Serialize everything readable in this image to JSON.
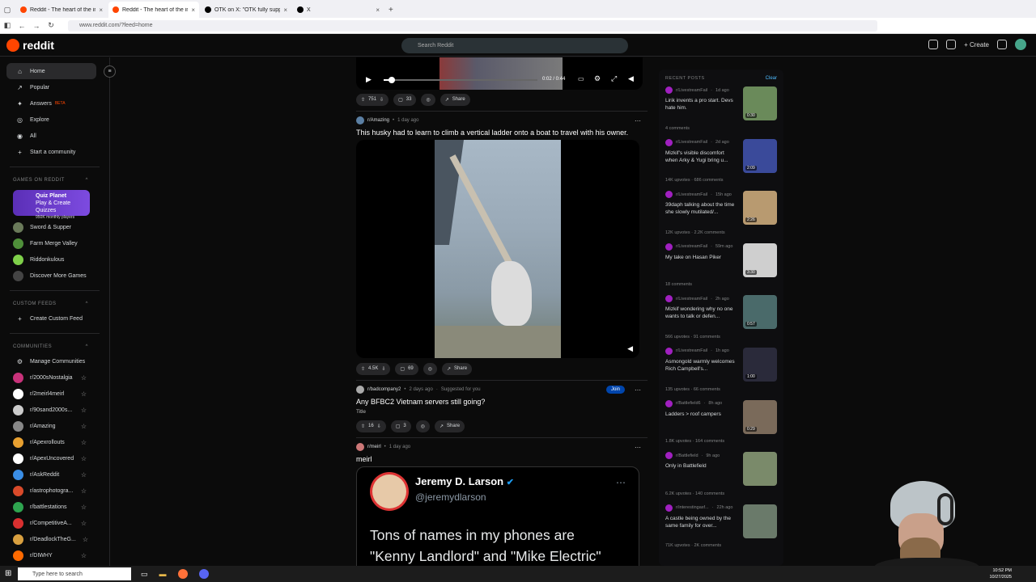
{
  "browser": {
    "tabs": [
      {
        "title": "Reddit - The heart of the intern",
        "active": false,
        "color": "#ff4500"
      },
      {
        "title": "Reddit - The heart of the in",
        "active": true,
        "color": "#ff4500"
      },
      {
        "title": "OTK on X: \"OTK fully supports c",
        "active": false,
        "color": "#000000"
      },
      {
        "title": "X",
        "active": false,
        "color": "#000000"
      }
    ],
    "url": "www.reddit.com/?feed=home"
  },
  "header": {
    "logo": "reddit",
    "search_placeholder": "Search Reddit",
    "create": "Create",
    "chat_badge": "1",
    "notif_badge": "1"
  },
  "sidebar": {
    "nav": [
      {
        "label": "Home",
        "icon": "home-icon",
        "active": true
      },
      {
        "label": "Popular",
        "icon": "popular-icon"
      },
      {
        "label": "Answers",
        "badge": "BETA",
        "icon": "answers-icon"
      },
      {
        "label": "Explore",
        "icon": "explore-icon"
      },
      {
        "label": "All",
        "icon": "all-icon"
      },
      {
        "label": "Start a community",
        "icon": "plus-icon"
      }
    ],
    "games_heading": "GAMES ON REDDIT",
    "quiz": {
      "title": "Quiz Planet",
      "subtitle": "Play & Create Quizzes",
      "players": "950K monthly players",
      "icon_text": "QUIZ"
    },
    "games": [
      {
        "label": "Sword & Supper",
        "color": "#6a7a5a"
      },
      {
        "label": "Farm Merge Valley",
        "color": "#4f8f3a"
      },
      {
        "label": "Riddonkulous",
        "color": "#7fd04a"
      },
      {
        "label": "Discover More Games",
        "color": "#444"
      }
    ],
    "custom_heading": "CUSTOM FEEDS",
    "create_feed": "Create Custom Feed",
    "communities_heading": "COMMUNITIES",
    "manage": "Manage Communities",
    "communities": [
      {
        "label": "r/2000sNostalgia",
        "color": "#c8327a"
      },
      {
        "label": "r/2meirl4meirl",
        "color": "#ffffff"
      },
      {
        "label": "r/90sand2000s...",
        "color": "#cccccc"
      },
      {
        "label": "r/Amazing",
        "color": "#888888"
      },
      {
        "label": "r/Apexrollouts",
        "color": "#e8a030"
      },
      {
        "label": "r/ApexUncovered",
        "color": "#ffffff"
      },
      {
        "label": "r/AskReddit",
        "color": "#3a8ee6"
      },
      {
        "label": "r/astrophotogra...",
        "color": "#d94a2a"
      },
      {
        "label": "r/battlestations",
        "color": "#2ea44f"
      },
      {
        "label": "r/CompetitiveA...",
        "color": "#d93030"
      },
      {
        "label": "r/DeadlockTheG...",
        "color": "#d9a040"
      },
      {
        "label": "r/DIWHY",
        "color": "#ff6a00"
      }
    ]
  },
  "feed": {
    "video_top": {
      "time": "0:02 / 0:44",
      "upvotes": "751",
      "comments": "33",
      "share": "Share"
    },
    "posts": [
      {
        "sub": "r/Amazing",
        "time": "1 day ago",
        "title": "This husky had to learn to climb a vertical ladder onto a boat to travel with his owner.",
        "upvotes": "4.5K",
        "comments": "69",
        "share": "Share"
      },
      {
        "sub": "r/badcompany2",
        "time": "2 days ago",
        "suggested": "Suggested for you",
        "join": "Join",
        "title": "Any BFBC2 Vietnam servers still going?",
        "body": "Title",
        "upvotes": "16",
        "comments": "3",
        "share": "Share"
      },
      {
        "sub": "r/meirl",
        "time": "1 day ago",
        "title": "meirl",
        "tweet": {
          "name": "Jeremy D. Larson",
          "handle": "@jeremydlarson",
          "text_line1": "Tons of names in my phones are",
          "text_line2": "\"Kenny Landlord\" and \"Mike Electric\""
        }
      }
    ]
  },
  "recent": {
    "heading": "RECENT POSTS",
    "clear": "Clear",
    "items": [
      {
        "sub": "r/LivestreamFail",
        "time": "1d ago",
        "title": "Lirik invents a pro start. Devs hate him.",
        "meta": "4 comments",
        "dur": "0:30",
        "thumb": "#6a8a5a"
      },
      {
        "sub": "r/LivestreamFail",
        "time": "2d ago",
        "title": "Mizkif's visible discomfort when Arky & Yugi bring u...",
        "meta": "14K upvotes · 686 comments",
        "dur": "2:09",
        "thumb": "#3a4a9a"
      },
      {
        "sub": "r/LivestreamFail",
        "time": "15h ago",
        "title": "39daph talking about the time she slowly mutilated/...",
        "meta": "12K upvotes · 2.2K comments",
        "dur": "2:26",
        "thumb": "#b89a70"
      },
      {
        "sub": "r/LivestreamFail",
        "time": "59m ago",
        "title": "My take on Hasan Piker",
        "meta": "18 comments",
        "dur": "3:30",
        "thumb": "#cfcfcf"
      },
      {
        "sub": "r/LivestreamFail",
        "time": "2h ago",
        "title": "Mizkif wondering why no one wants to talk or defen...",
        "meta": "566 upvotes · 91 comments",
        "dur": "0:57",
        "thumb": "#4a6a6a"
      },
      {
        "sub": "r/LivestreamFail",
        "time": "1h ago",
        "title": "Asmongold warmly welcomes Rich Campbell's...",
        "meta": "135 upvotes · 66 comments",
        "dur": "1:00",
        "thumb": "#2a2a3a"
      },
      {
        "sub": "r/Battlefield6",
        "time": "8h ago",
        "title": "Ladders > roof campers",
        "meta": "1.8K upvotes · 164 comments",
        "dur": "0:29",
        "thumb": "#7a6a5a"
      },
      {
        "sub": "r/Battlefield",
        "time": "9h ago",
        "title": "Only in Battlefield",
        "meta": "6.2K upvotes · 140 comments",
        "dur": "",
        "thumb": "#7a8a6a"
      },
      {
        "sub": "r/interestingasf...",
        "time": "22h ago",
        "title": "A castle being owned by the same family for over...",
        "meta": "71K upvotes · 2K comments",
        "dur": "",
        "thumb": "#6a7a6a"
      }
    ]
  },
  "taskbar": {
    "search": "Type here to search",
    "time": "10:52 PM",
    "date": "10/27/2025"
  }
}
